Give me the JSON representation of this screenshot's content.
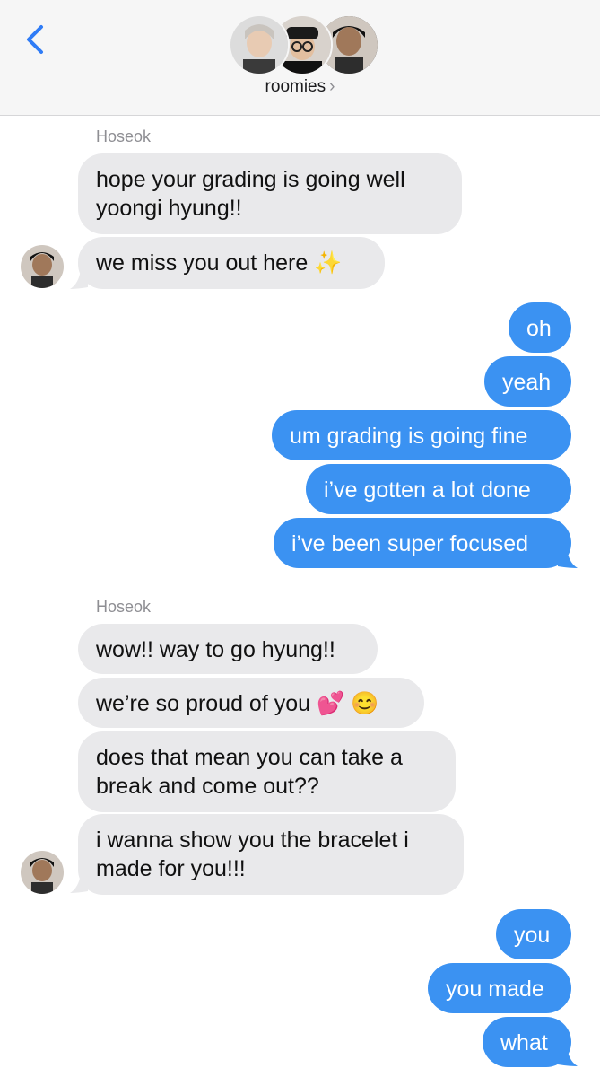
{
  "header": {
    "title": "roomies",
    "chevron": "›",
    "back_icon": "chevron-left-icon",
    "accent": "#2f7cf6"
  },
  "colors": {
    "incoming_bubble": "#e9e9eb",
    "outgoing_bubble": "#3b92f2",
    "sender_label": "#8e8e93"
  },
  "messages": [
    {
      "direction": "in",
      "sender": "Hoseok",
      "text": "hope your grading is going well\nyoongi hyung!!"
    },
    {
      "direction": "in",
      "text": "we miss you out here ✨"
    },
    {
      "direction": "out",
      "text": "oh"
    },
    {
      "direction": "out",
      "text": "yeah"
    },
    {
      "direction": "out",
      "text": "um grading is going fine"
    },
    {
      "direction": "out",
      "text": "i’ve gotten a lot done"
    },
    {
      "direction": "out",
      "text": "i’ve been super focused"
    },
    {
      "direction": "in",
      "sender": "Hoseok",
      "text": "wow!! way to go hyung!!"
    },
    {
      "direction": "in",
      "text": "we’re so proud of you 💕 😊"
    },
    {
      "direction": "in",
      "text": "does that mean you can take a\nbreak and come out??"
    },
    {
      "direction": "in",
      "text": "i wanna show you the bracelet i\nmade for you!!!"
    },
    {
      "direction": "out",
      "text": "you"
    },
    {
      "direction": "out",
      "text": "you made"
    },
    {
      "direction": "out",
      "text": "what"
    }
  ]
}
